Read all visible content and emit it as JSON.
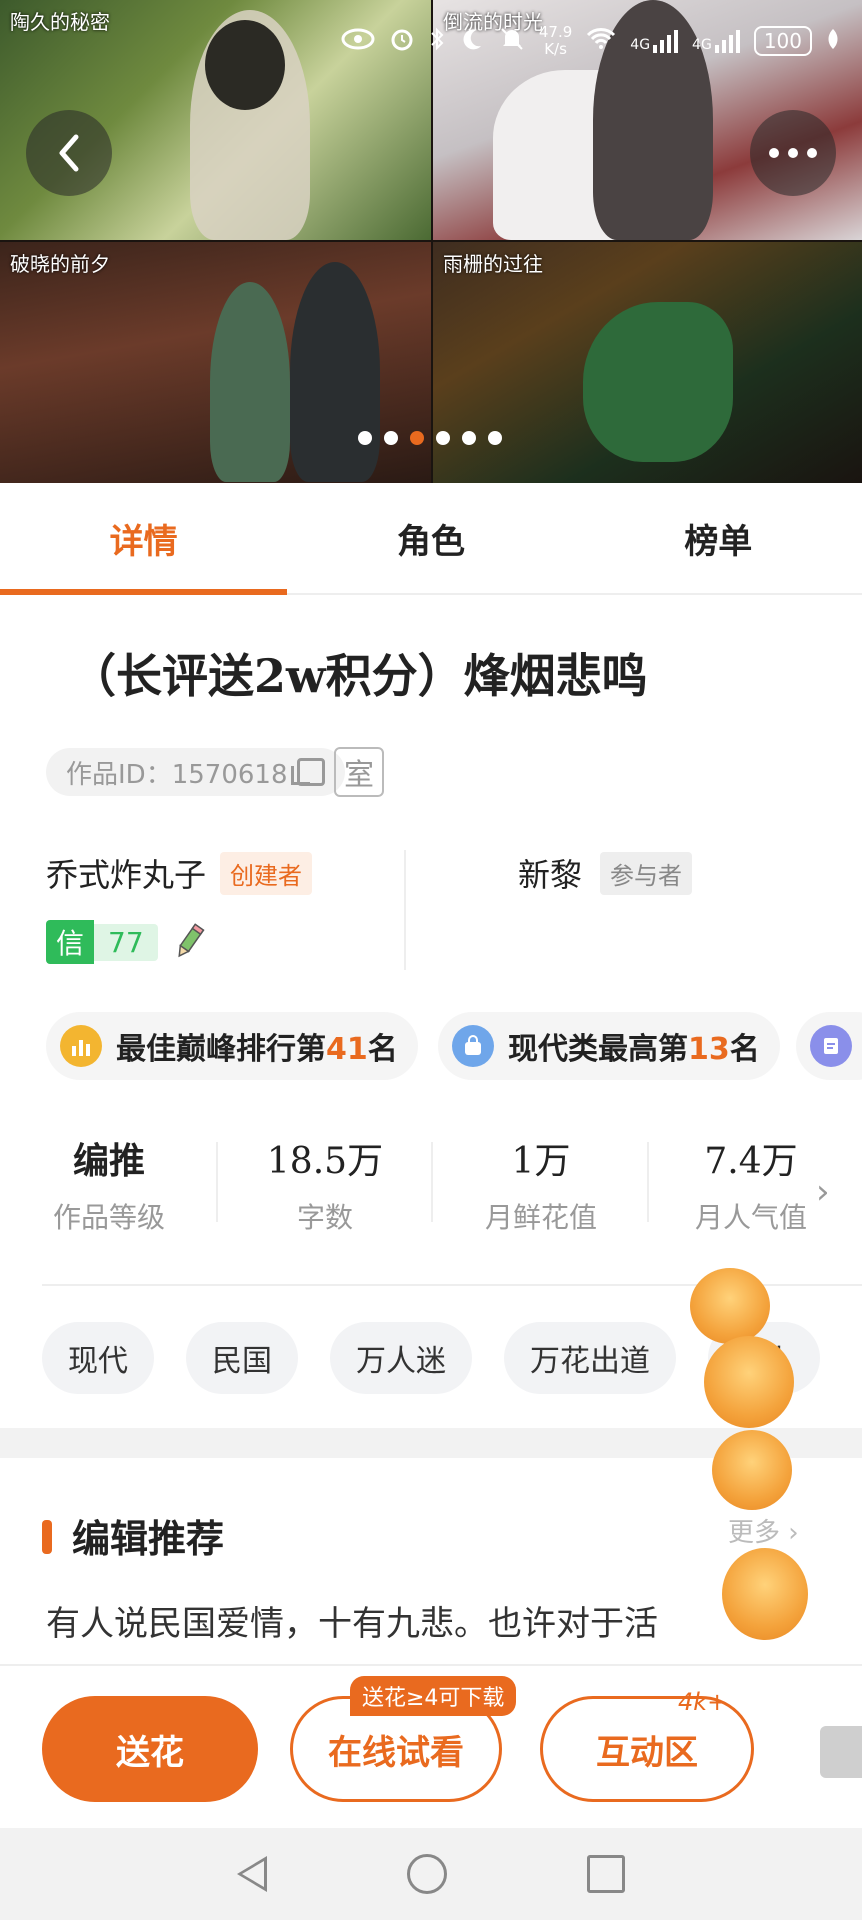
{
  "status_bar": {
    "speed_value": "47.9",
    "speed_unit": "K/s",
    "network_1": "4G",
    "network_2": "4G",
    "battery": "100"
  },
  "banner": {
    "tiles": [
      {
        "caption": "陶久的秘密"
      },
      {
        "caption": "倒流的时光"
      },
      {
        "caption": "破晓的前夕"
      },
      {
        "caption": "雨栅的过往"
      }
    ],
    "page_count": 6,
    "active_page": 3
  },
  "tabs": [
    {
      "label": "详情"
    },
    {
      "label": "角色"
    },
    {
      "label": "榜单"
    }
  ],
  "work": {
    "title": "（长评送2w积分）烽烟悲鸣",
    "id_label": "作品ID：1570618",
    "room_icon": "室"
  },
  "creator": {
    "name": "乔式炸丸子",
    "role": "创建者",
    "credit_key": "信",
    "credit_value": "77"
  },
  "participant": {
    "name": "新黎",
    "role": "参与者"
  },
  "ranks": [
    {
      "prefix": "最佳巅峰排行第",
      "num": "41",
      "suffix": "名",
      "icon": "bar-chart-icon",
      "color": "#f3b530"
    },
    {
      "prefix": "现代类最高第",
      "num": "13",
      "suffix": "名",
      "icon": "bag-icon",
      "color": "#6fa6ea"
    },
    {
      "prefix": "",
      "num": "",
      "suffix": "",
      "icon": "doc-icon",
      "color": "#8a8fea"
    }
  ],
  "stats": [
    {
      "value": "编推",
      "label": "作品等级"
    },
    {
      "value": "18.5万",
      "label": "字数"
    },
    {
      "value": "1万",
      "label": "月鲜花值"
    },
    {
      "value": "7.4万",
      "label": "月人气值"
    }
  ],
  "tags": [
    "现代",
    "民国",
    "万人迷",
    "万花出道",
    "动人"
  ],
  "recommend": {
    "title": "编辑推荐",
    "more": "更多",
    "text": "有人说民国爱情，十有九悲。也许对于活"
  },
  "bottom": {
    "flower_label": "送花",
    "trial_label": "在线试看",
    "trial_badge": "送花≥4可下载",
    "interact_label": "互动区",
    "interact_count": "4k+"
  }
}
